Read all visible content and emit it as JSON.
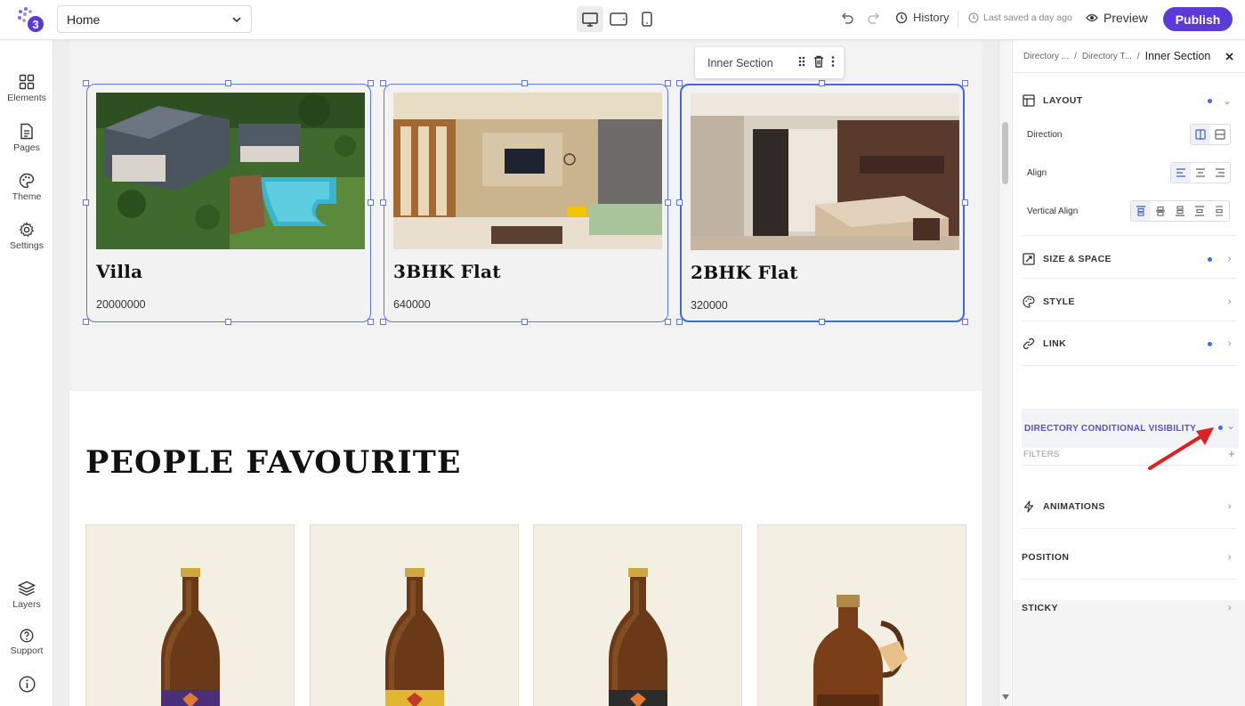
{
  "topbar": {
    "page_select": "Home",
    "history_label": "History",
    "saved_label": "Last saved a day ago",
    "preview_label": "Preview",
    "publish_label": "Publish"
  },
  "leftbar": {
    "items": [
      {
        "label": "Elements",
        "icon": "grid-icon"
      },
      {
        "label": "Pages",
        "icon": "page-icon"
      },
      {
        "label": "Theme",
        "icon": "palette-icon"
      },
      {
        "label": "Settings",
        "icon": "gear-icon"
      }
    ],
    "bottom": [
      {
        "label": "Layers",
        "icon": "layers-icon"
      },
      {
        "label": "Support",
        "icon": "help-icon"
      }
    ]
  },
  "canvas": {
    "toolbar_label": "Inner Section",
    "cards": [
      {
        "title": "Villa",
        "price": "20000000",
        "image": "villa-aerial-photo"
      },
      {
        "title": "3BHK Flat",
        "price": "640000",
        "image": "living-room-photo"
      },
      {
        "title": "2BHK Flat",
        "price": "320000",
        "image": "bedroom-photo"
      }
    ],
    "section_title": "PEOPLE FAVOURITE",
    "products": [
      "beer-bottle-purple",
      "beer-bottle-gold",
      "beer-bottle-dark",
      "growler-jug"
    ]
  },
  "panel": {
    "breadcrumb": [
      "Directory ...",
      "Directory T...",
      "Inner Section"
    ],
    "layout_label": "LAYOUT",
    "direction_label": "Direction",
    "align_label": "Align",
    "valign_label": "Vertical Align",
    "sections": {
      "size_space": "SIZE & SPACE",
      "style": "STYLE",
      "link": "LINK",
      "dcv": "DIRECTORY CONDITIONAL VISIBILITY",
      "filters": "FILTERS",
      "animations": "ANIMATIONS",
      "position": "POSITION",
      "sticky": "STICKY"
    }
  },
  "colors": {
    "accent": "#5b3bd8",
    "selection": "#4466e0",
    "annotation_arrow": "#e02020"
  }
}
